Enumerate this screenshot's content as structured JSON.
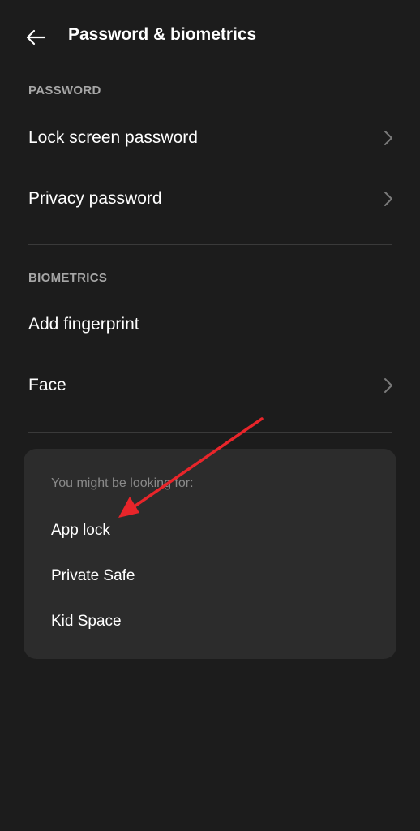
{
  "header": {
    "title": "Password & biometrics",
    "back_icon": "arrow-left-icon"
  },
  "sections": {
    "password": {
      "header": "PASSWORD",
      "items": [
        {
          "label": "Lock screen password",
          "has_chevron": true
        },
        {
          "label": "Privacy password",
          "has_chevron": true
        }
      ]
    },
    "biometrics": {
      "header": "BIOMETRICS",
      "items": [
        {
          "label": "Add fingerprint",
          "has_chevron": false
        },
        {
          "label": "Face",
          "has_chevron": true
        }
      ]
    }
  },
  "suggestions": {
    "title": "You might be looking for:",
    "items": [
      "App lock",
      "Private Safe",
      "Kid Space"
    ]
  },
  "colors": {
    "background": "#1c1c1c",
    "card": "#2c2c2c",
    "section_header": "#a6a6a6",
    "annotation_arrow": "#e8252a"
  }
}
